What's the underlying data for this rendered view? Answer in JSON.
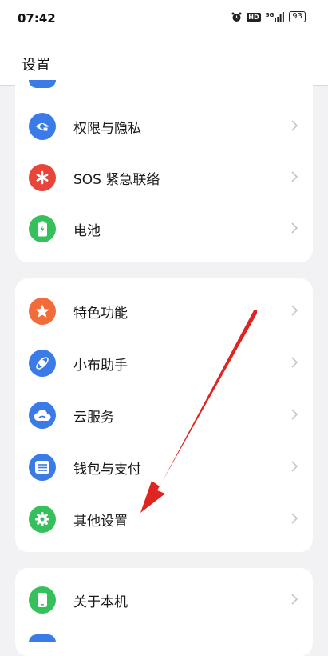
{
  "status_bar": {
    "time": "07:42",
    "icons": [
      "alarm-icon",
      "hd-icon",
      "5g-signal-icon",
      "battery-icon"
    ],
    "hd": "HD",
    "network": "5G",
    "battery": "93"
  },
  "header": {
    "title": "设置"
  },
  "groups": [
    {
      "items": [
        {
          "label": "权限与隐私",
          "icon": "privacy-icon",
          "color": "#3a7be8"
        },
        {
          "label": "SOS 紧急联络",
          "icon": "sos-icon",
          "color": "#e8443a"
        },
        {
          "label": "电池",
          "icon": "battery-icon",
          "color": "#35c05c"
        }
      ]
    },
    {
      "items": [
        {
          "label": "特色功能",
          "icon": "star-icon",
          "color": "#f26b3a"
        },
        {
          "label": "小布助手",
          "icon": "assistant-icon",
          "color": "#3a7be8"
        },
        {
          "label": "云服务",
          "icon": "cloud-icon",
          "color": "#3a7be8"
        },
        {
          "label": "钱包与支付",
          "icon": "wallet-icon",
          "color": "#3a7be8"
        },
        {
          "label": "其他设置",
          "icon": "gear-icon",
          "color": "#35c05c"
        }
      ]
    },
    {
      "items": [
        {
          "label": "关于本机",
          "icon": "phone-icon",
          "color": "#35c05c"
        }
      ]
    }
  ],
  "annotation": {
    "type": "red-arrow",
    "color": "#e0241f",
    "points_to": "其他设置"
  }
}
